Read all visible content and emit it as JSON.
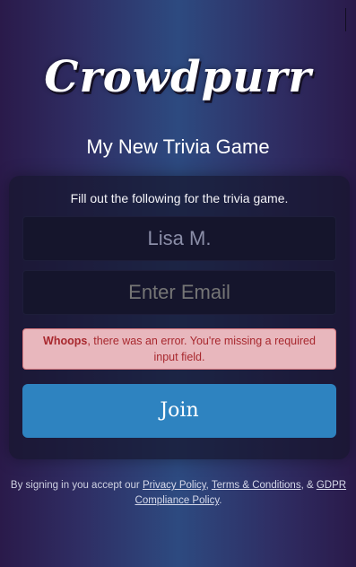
{
  "app": {
    "logo_text": "Crowdpurr"
  },
  "game": {
    "title": "My New Trivia Game"
  },
  "form": {
    "instruction": "Fill out the following for the trivia game.",
    "name_value": "Lisa M.",
    "email_placeholder": "Enter Email",
    "error_strong": "Whoops",
    "error_text": ", there was an error. You're missing a required input field.",
    "join_label": "Join"
  },
  "legal": {
    "prefix": "By signing in you accept our ",
    "privacy": "Privacy Policy",
    "sep1": ", ",
    "terms": "Terms & Conditions",
    "sep2": ", & ",
    "gdpr": "GDPR Compliance Policy",
    "suffix": "."
  },
  "colors": {
    "join_button": "#2e83c0",
    "error_bg": "#e8b7bd",
    "error_text": "#a8282e"
  }
}
